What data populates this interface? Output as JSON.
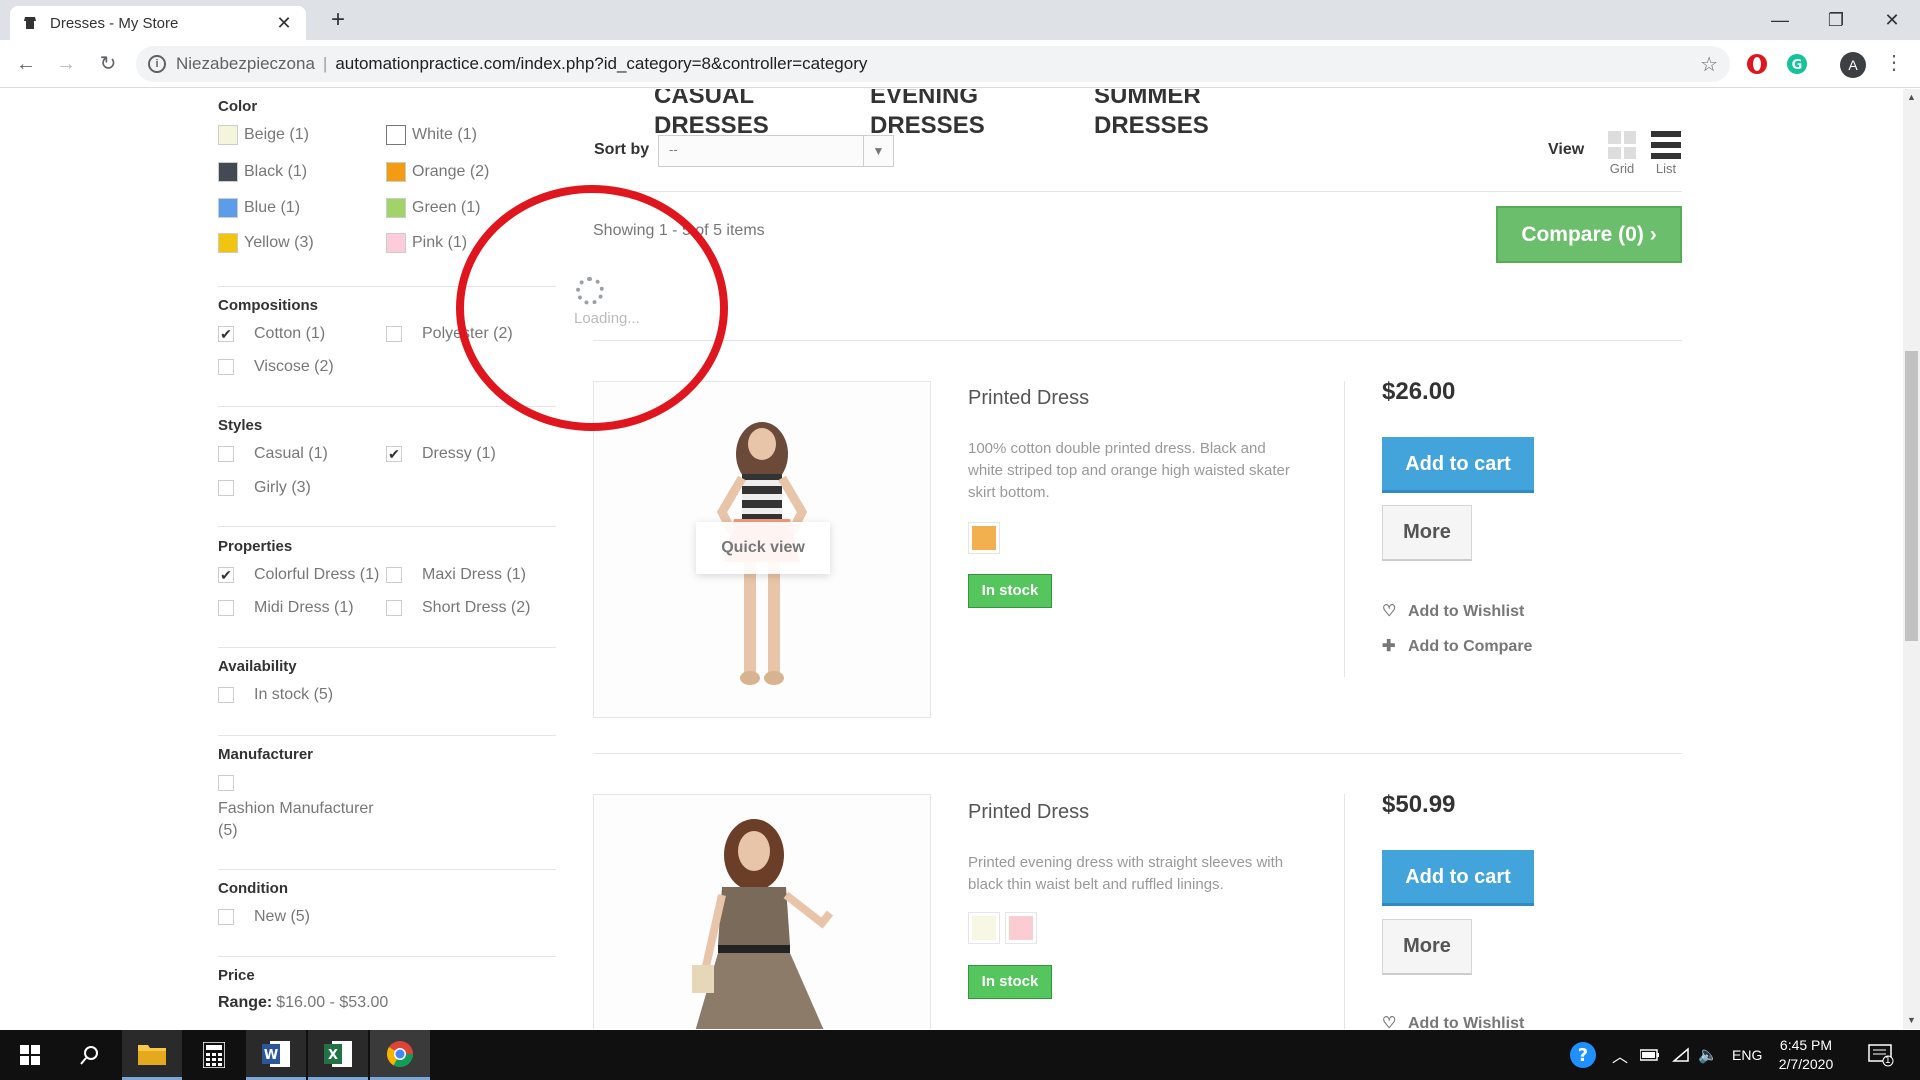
{
  "browser": {
    "tab_title": "Dresses - My Store",
    "tab_close": "✕",
    "new_tab": "+",
    "security_label": "Niezabezpieczona",
    "url": "automationpractice.com/index.php?id_category=8&controller=category",
    "profile_initial": "A"
  },
  "window_controls": {
    "minimize": "—",
    "maximize": "❐",
    "close": "✕"
  },
  "subcategories": [
    {
      "line1": "CASUAL",
      "line2": "DRESSES"
    },
    {
      "line1": "EVENING",
      "line2": "DRESSES"
    },
    {
      "line1": "SUMMER",
      "line2": "DRESSES"
    }
  ],
  "filters": {
    "color": {
      "title": "Color",
      "items": [
        {
          "label": "Beige (1)",
          "hex": "#f5f5dc"
        },
        {
          "label": "White (1)",
          "hex": "#ffffff"
        },
        {
          "label": "Black (1)",
          "hex": "#434a54"
        },
        {
          "label": "Orange (2)",
          "hex": "#f39c11"
        },
        {
          "label": "Blue (1)",
          "hex": "#5d9cec"
        },
        {
          "label": "Green (1)",
          "hex": "#a0d468"
        },
        {
          "label": "Yellow (3)",
          "hex": "#f1c40f"
        },
        {
          "label": "Pink (1)",
          "hex": "#fcccdb"
        }
      ]
    },
    "compositions": {
      "title": "Compositions",
      "items": [
        {
          "label": "Cotton (1)",
          "checked": true
        },
        {
          "label": "Polyester (2)",
          "checked": false
        },
        {
          "label": "Viscose (2)",
          "checked": false
        }
      ]
    },
    "styles": {
      "title": "Styles",
      "items": [
        {
          "label": "Casual (1)",
          "checked": false
        },
        {
          "label": "Dressy (1)",
          "checked": true
        },
        {
          "label": "Girly (3)",
          "checked": false
        }
      ]
    },
    "properties": {
      "title": "Properties",
      "items": [
        {
          "label": "Colorful Dress (1)",
          "checked": true
        },
        {
          "label": "Maxi Dress (1)",
          "checked": false
        },
        {
          "label": "Midi Dress (1)",
          "checked": false
        },
        {
          "label": "Short Dress (2)",
          "checked": false
        }
      ]
    },
    "availability": {
      "title": "Availability",
      "items": [
        {
          "label": "In stock (5)",
          "checked": false
        }
      ]
    },
    "manufacturer": {
      "title": "Manufacturer",
      "items": [
        {
          "label_line1": "Fashion Manufacturer",
          "label_line2": "(5)",
          "checked": false
        }
      ]
    },
    "condition": {
      "title": "Condition",
      "items": [
        {
          "label": "New (5)",
          "checked": false
        }
      ]
    },
    "price": {
      "title": "Price",
      "range_label": "Range:",
      "range_value": "$16.00 - $53.00"
    }
  },
  "toolbar": {
    "sort_label": "Sort by",
    "sort_value": "--",
    "view_label": "View",
    "view_grid": "Grid",
    "view_list": "List",
    "showing": "Showing 1 - 5 of 5 items",
    "compare": "Compare (0)",
    "compare_arrow": "›"
  },
  "loader": {
    "text": "Loading..."
  },
  "products": [
    {
      "name": "Printed Dress",
      "description": "100% cotton double printed dress. Black and white striped top and orange high waisted skater skirt bottom.",
      "colors": [
        "#f3b04f"
      ],
      "stock": "In stock",
      "price": "$26.00",
      "add_to_cart": "Add to cart",
      "more": "More",
      "wishlist": "Add to Wishlist",
      "compare": "Add to Compare",
      "quick_view": "Quick view"
    },
    {
      "name": "Printed Dress",
      "description": "Printed evening dress with straight sleeves with black thin waist belt and ruffled linings.",
      "colors": [
        "#f7f7e3",
        "#fcccd3"
      ],
      "stock": "In stock",
      "price": "$50.99",
      "add_to_cart": "Add to cart",
      "more": "More",
      "wishlist": "Add to Wishlist"
    }
  ],
  "taskbar": {
    "language": "ENG",
    "time": "6:45 PM",
    "date": "2/7/2020",
    "notifications": "1"
  }
}
